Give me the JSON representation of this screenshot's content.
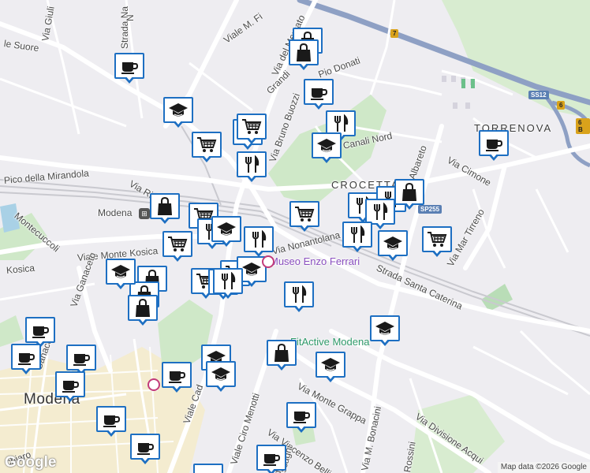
{
  "map": {
    "street_labels": [
      {
        "id": "via-giuli",
        "text": "Via Giuli"
      },
      {
        "id": "strada-na",
        "text": "Strada Na"
      },
      {
        "id": "viale-m-fi",
        "text": "Viale M. Fi"
      },
      {
        "id": "via-del-mercato",
        "text": "Via del Mercato"
      },
      {
        "id": "via-le-suore",
        "text": "le Suore"
      },
      {
        "id": "via-grandi",
        "text": "Grandi"
      },
      {
        "id": "via-pio-donati",
        "text": "Pio Donati"
      },
      {
        "id": "via-bruno-buozzi",
        "text": "Via Bruno Buozzi"
      },
      {
        "id": "canali-nord",
        "text": "Canali Nord"
      },
      {
        "id": "via-albareto",
        "text": "Albareto"
      },
      {
        "id": "via-cimone",
        "text": "Via Cimone"
      },
      {
        "id": "pico-mirandola",
        "text": "Pico della Mirandola"
      },
      {
        "id": "via-rita",
        "text": "Via Rita L"
      },
      {
        "id": "via-nonantolana",
        "text": "Via Nonantolana"
      },
      {
        "id": "via-mar-tirreno",
        "text": "Via Mar Tirreno"
      },
      {
        "id": "strada-santa-caterina",
        "text": "Strada Santa Caterina"
      },
      {
        "id": "viale-montecuccoli",
        "text": "Montecuccoli"
      },
      {
        "id": "viale-monte-kosica",
        "text": "Viale Monte Kosica"
      },
      {
        "id": "kosica",
        "text": "Kosica"
      },
      {
        "id": "via-ganaceto",
        "text": "Via Ganaceto"
      },
      {
        "id": "via-ganaceto-2",
        "text": "Ganaceto"
      },
      {
        "id": "viale-cad",
        "text": "Viale Cad"
      },
      {
        "id": "via-monte-grappa",
        "text": "Via Monte Grappa"
      },
      {
        "id": "viale-ciro-menotti",
        "text": "Viale Ciro Menotti"
      },
      {
        "id": "via-vincenzo-bellini",
        "text": "Via Vincenzo Bellini"
      },
      {
        "id": "via-m-bonacini",
        "text": "Via M. Bonacini"
      },
      {
        "id": "via-divisione-acqui",
        "text": "Via Divisione Acqui"
      },
      {
        "id": "via-rossini",
        "text": "Rossini"
      },
      {
        "id": "via-scagni",
        "text": "scagni"
      },
      {
        "id": "via-chiaro",
        "text": "chiaro"
      },
      {
        "id": "via-rdi",
        "text": "rdi"
      },
      {
        "id": "via-n",
        "text": "N"
      }
    ],
    "area_labels": [
      {
        "id": "torrenova",
        "text": "TORRENOVA"
      },
      {
        "id": "crocetta",
        "text": "CROCETTA"
      },
      {
        "id": "modena-city",
        "text": "Modena"
      }
    ],
    "place_labels": [
      {
        "id": "modena-station",
        "text": "Modena"
      },
      {
        "id": "museo-enzo-ferrari",
        "text": "Museo Enzo Ferrari"
      },
      {
        "id": "fitactive-modena",
        "text": "FitActive Modena"
      }
    ],
    "road_shields": [
      {
        "id": "ss12",
        "text": "SS12"
      },
      {
        "id": "sp255",
        "text": "SP255"
      },
      {
        "id": "r7",
        "text": "7"
      },
      {
        "id": "r6",
        "text": "6"
      },
      {
        "id": "r6b",
        "text": "6 B"
      }
    ],
    "markers": [
      {
        "type": "shopping"
      },
      {
        "type": "cafe"
      },
      {
        "type": "cafe"
      },
      {
        "type": "shopping"
      },
      {
        "type": "education"
      },
      {
        "type": "grocery"
      },
      {
        "type": "grocery"
      },
      {
        "type": "grocery"
      },
      {
        "type": "restaurant"
      },
      {
        "type": "restaurant"
      },
      {
        "type": "education"
      },
      {
        "type": "cafe"
      },
      {
        "type": "grocery"
      },
      {
        "type": "restaurant"
      },
      {
        "type": "restaurant"
      },
      {
        "type": "shopping"
      },
      {
        "type": "restaurant"
      },
      {
        "type": "shopping"
      },
      {
        "type": "grocery"
      },
      {
        "type": "restaurant"
      },
      {
        "type": "education"
      },
      {
        "type": "grocery"
      },
      {
        "type": "restaurant"
      },
      {
        "type": "restaurant"
      },
      {
        "type": "education"
      },
      {
        "type": "grocery"
      },
      {
        "type": "grocery"
      },
      {
        "type": "restaurant"
      },
      {
        "type": "grocery"
      },
      {
        "type": "education"
      },
      {
        "type": "shopping"
      },
      {
        "type": "shopping"
      },
      {
        "type": "shopping"
      },
      {
        "type": "restaurant"
      },
      {
        "type": "education"
      },
      {
        "type": "cafe"
      },
      {
        "type": "cafe"
      },
      {
        "type": "cafe"
      },
      {
        "type": "cafe"
      },
      {
        "type": "education"
      },
      {
        "type": "education"
      },
      {
        "type": "education"
      },
      {
        "type": "cafe"
      },
      {
        "type": "shopping"
      },
      {
        "type": "education"
      },
      {
        "type": "cafe"
      },
      {
        "type": "cafe"
      },
      {
        "type": "cafe"
      },
      {
        "type": "cafe"
      },
      {
        "type": "cafe"
      },
      {
        "type": "restaurant"
      }
    ],
    "google_logo": "Google",
    "attribution": "Map data ©2026 Google"
  },
  "colors": {
    "marker_border": "#1d6fc2",
    "marker_icon": "#1a1a1a",
    "park": "#c8e6c9",
    "water": "#a9d1e6",
    "highway": "#8ea0c4",
    "road": "#ffffff",
    "city_center": "#f5eccc"
  }
}
